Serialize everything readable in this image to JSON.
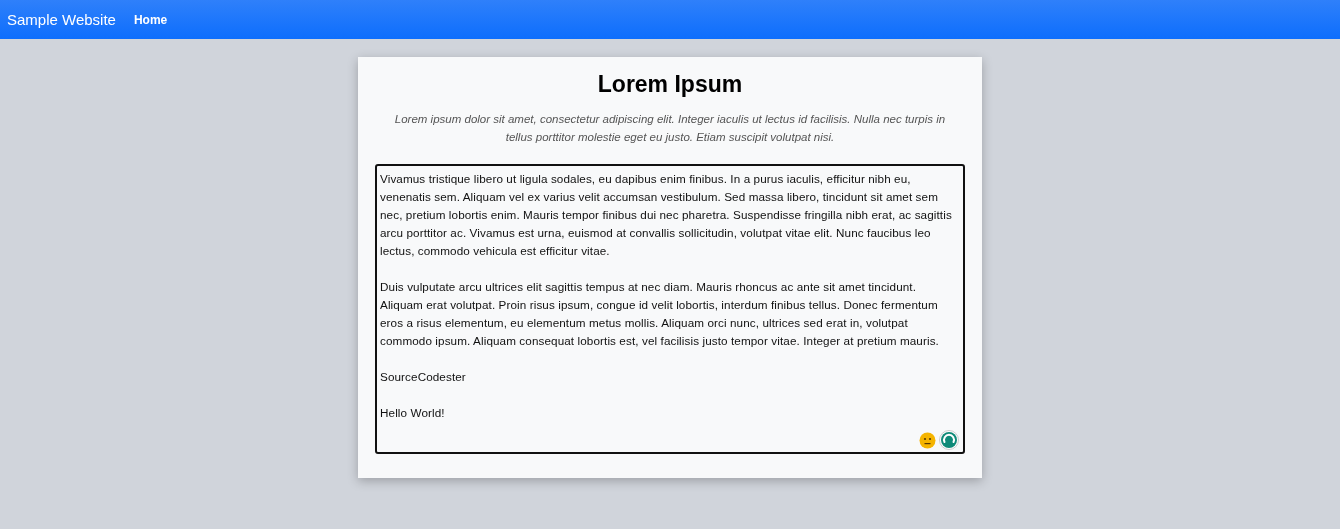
{
  "navbar": {
    "brand": "Sample Website",
    "links": [
      {
        "label": "Home",
        "selected": true
      }
    ]
  },
  "card": {
    "title": "Lorem Ipsum",
    "subtitle": "Lorem ipsum dolor sit amet, consectetur adipiscing elit. Integer iaculis ut lectus id facilisis. Nulla nec turpis in tellus porttitor molestie eget eu justo. Etiam suscipit volutpat nisi.",
    "editor": {
      "value": "Vivamus tristique libero ut ligula sodales, eu dapibus enim finibus. In a purus iaculis, efficitur nibh eu, venenatis sem. Aliquam vel ex varius velit accumsan vestibulum. Sed massa libero, tincidunt sit amet sem nec, pretium lobortis enim. Mauris tempor finibus dui nec pharetra. Suspendisse fringilla nibh erat, ac sagittis arcu porttitor ac. Vivamus est urna, euismod at convallis sollicitudin, volutpat vitae elit. Nunc faucibus leo lectus, commodo vehicula est efficitur vitae.\n\nDuis vulputate arcu ultrices elit sagittis tempus at nec diam. Mauris rhoncus ac ante sit amet tincidunt. Aliquam erat volutpat. Proin risus ipsum, congue id velit lobortis, interdum finibus tellus. Donec fermentum eros a risus elementum, eu elementum metus mollis. Aliquam orci nunc, ultrices sed erat in, volutpat commodo ipsum. Aliquam consequat lobortis est, vel facilisis justo tempor vitae. Integer at pretium mauris.\n\nSourceCodester\n\nHello World!",
      "focused": true
    }
  }
}
